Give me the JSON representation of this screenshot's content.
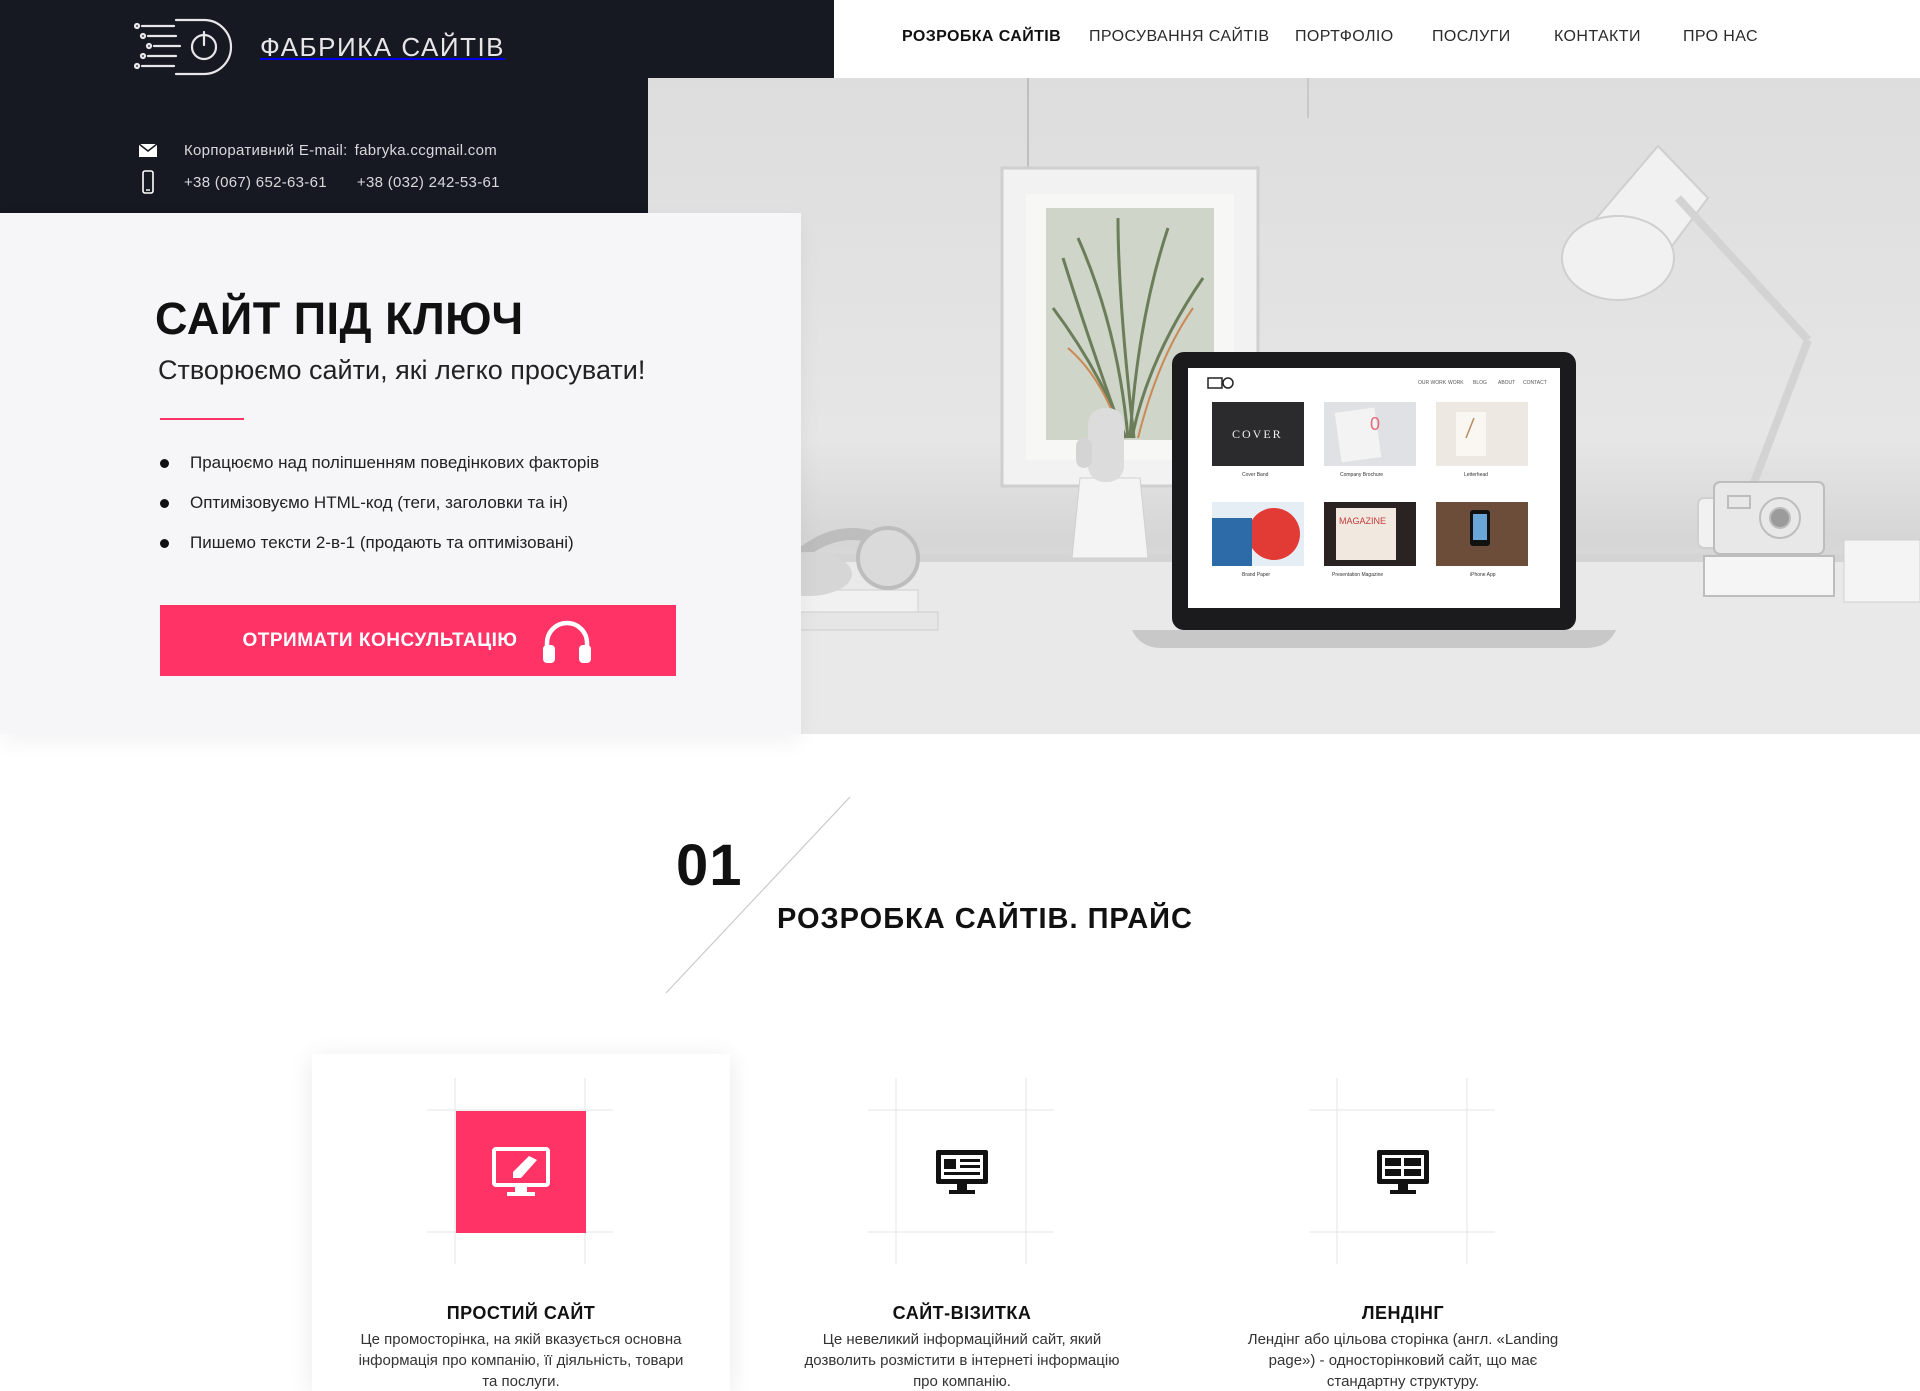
{
  "brand": {
    "name": "ФАБРИКА САЙТІВ",
    "logo_icon": "speed-power-logo-icon"
  },
  "contacts": {
    "email_label": "Корпоративний E-mail:",
    "email": "fabryka.ccgmail.com",
    "phone_1": "+38 (067) 652-63-61",
    "phone_2": "+38 (032) 242-53-61",
    "email_icon": "envelope-icon",
    "phone_icon": "mobile-phone-icon"
  },
  "nav": {
    "items": [
      {
        "label": "РОЗРОБКА САЙТІВ",
        "active": true
      },
      {
        "label": "ПРОСУВАННЯ САЙТІВ",
        "active": false
      },
      {
        "label": "ПОРТФОЛІО",
        "active": false
      },
      {
        "label": "ПОСЛУГИ",
        "active": false
      },
      {
        "label": "КОНТАКТИ",
        "active": false
      },
      {
        "label": "ПРО НАС",
        "active": false
      }
    ]
  },
  "hero": {
    "title": "САЙТ ПІД КЛЮЧ",
    "subtitle": "Створюємо сайти, які легко просувати!",
    "bullets": [
      "Працюємо над поліпшенням поведінкових факторів",
      "Оптимізовуємо HTML-код (теги, заголовки та ін)",
      "Пишемо тексти 2-в-1 (продають  та  оптимізовані)"
    ],
    "cta_label": "ОТРИМАТИ КОНСУЛЬТАЦІЮ",
    "cta_icon": "headphones-icon"
  },
  "laptop_screen": {
    "items": [
      {
        "caption": "Cover Band"
      },
      {
        "caption": "Company Brochure"
      },
      {
        "caption": "Letterhead"
      },
      {
        "caption": "Brand Paper"
      },
      {
        "caption": "Presentation Magazine"
      },
      {
        "caption": "iPhone App"
      }
    ],
    "cover_text": "COVER",
    "magazine_text": "MAGAZINE"
  },
  "section": {
    "number": "01",
    "title": "РОЗРОБКА САЙТІВ. ПРАЙС"
  },
  "cards": [
    {
      "title": "ПРОСТИЙ САЙТ",
      "description": "Це промосторінка, на якій вказується основна інформація про компанію, її діяльність, товари та послуги.",
      "icon": "monitor-pencil-icon",
      "active": true
    },
    {
      "title": "САЙТ-ВІЗИТКА",
      "description": "Це невеликий інформаційний сайт, який дозволить розмістити в інтернеті інформацію про компанію.",
      "icon": "monitor-card-icon",
      "active": false
    },
    {
      "title": "ЛЕНДІНГ",
      "description": "Лендінг або цільова сторінка (англ. «Landing page») - односторінковий сайт, що має стандартну структуру.",
      "icon": "monitor-grid-icon",
      "active": false
    }
  ],
  "colors": {
    "accent": "#ff3366",
    "dark": "#161922",
    "card_bg": "#f6f6f8"
  }
}
